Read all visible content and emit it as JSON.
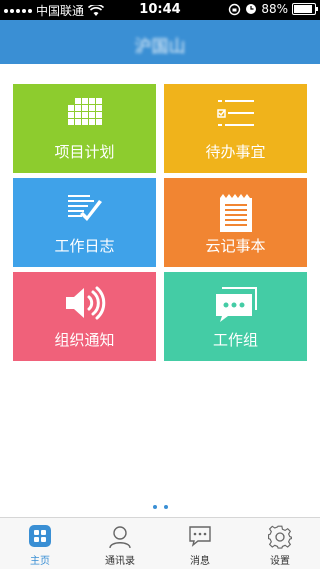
{
  "status_bar": {
    "carrier": "中国联通",
    "time": "10:44",
    "battery": "88%",
    "battery_level": 0.88
  },
  "header": {
    "title": "沪国山"
  },
  "tiles": [
    {
      "label": "项目计划",
      "color": "#8dcc2e",
      "icon": "grid-icon"
    },
    {
      "label": "待办事宜",
      "color": "#f0b31b",
      "icon": "checklist-icon"
    },
    {
      "label": "工作日志",
      "color": "#3fa2e9",
      "icon": "document-check-icon"
    },
    {
      "label": "云记事本",
      "color": "#f18532",
      "icon": "notepad-icon"
    },
    {
      "label": "组织通知",
      "color": "#f0617a",
      "icon": "speaker-icon"
    },
    {
      "label": "工作组",
      "color": "#44cca5",
      "icon": "chat-icon"
    }
  ],
  "tabbar": [
    {
      "label": "主页",
      "icon": "home-grid-icon",
      "active": true
    },
    {
      "label": "通讯录",
      "icon": "person-icon",
      "active": false
    },
    {
      "label": "消息",
      "icon": "message-icon",
      "active": false
    },
    {
      "label": "设置",
      "icon": "gear-icon",
      "active": false
    }
  ],
  "colors": {
    "header": "#3a8fd4",
    "accent": "#3a8fd4"
  }
}
